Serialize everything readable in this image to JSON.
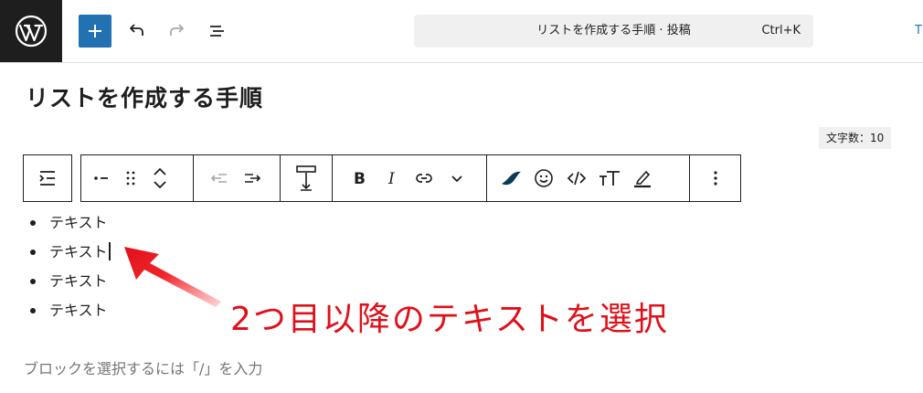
{
  "header": {
    "command_bar": {
      "title": "リストを作成する手順 · 投稿",
      "shortcut": "Ctrl+K"
    },
    "right_edge_fragment": "T"
  },
  "editor": {
    "post_title": "リストを作成する手順",
    "char_count": "文字数：10",
    "list_items": [
      "テキスト",
      "テキスト",
      "テキスト",
      "テキスト"
    ],
    "placeholder": "ブロックを選択するには「/」を入力"
  },
  "annotation": {
    "text": "2つ目以降のテキストを選択",
    "color": "#e0101a"
  },
  "colors": {
    "brand_dark": "#1e1e1e",
    "accent_blue": "#2271b1",
    "muted_text": "#757575"
  },
  "icons": {
    "logo": "wordpress-logo",
    "toolbar": [
      "add-block-icon",
      "undo-icon",
      "redo-icon",
      "document-overview-icon"
    ],
    "block_toolbar": [
      "parent-block-icon",
      "list-item-icon",
      "drag-handle-icon",
      "move-up-icon",
      "move-down-icon",
      "outdent-icon",
      "indent-icon",
      "align-height-icon",
      "bold-icon",
      "italic-icon",
      "link-icon",
      "more-formatting-icon",
      "plugin-leaf-icon",
      "emoji-icon",
      "inline-code-icon",
      "text-size-icon",
      "highlight-icon",
      "options-icon"
    ]
  }
}
